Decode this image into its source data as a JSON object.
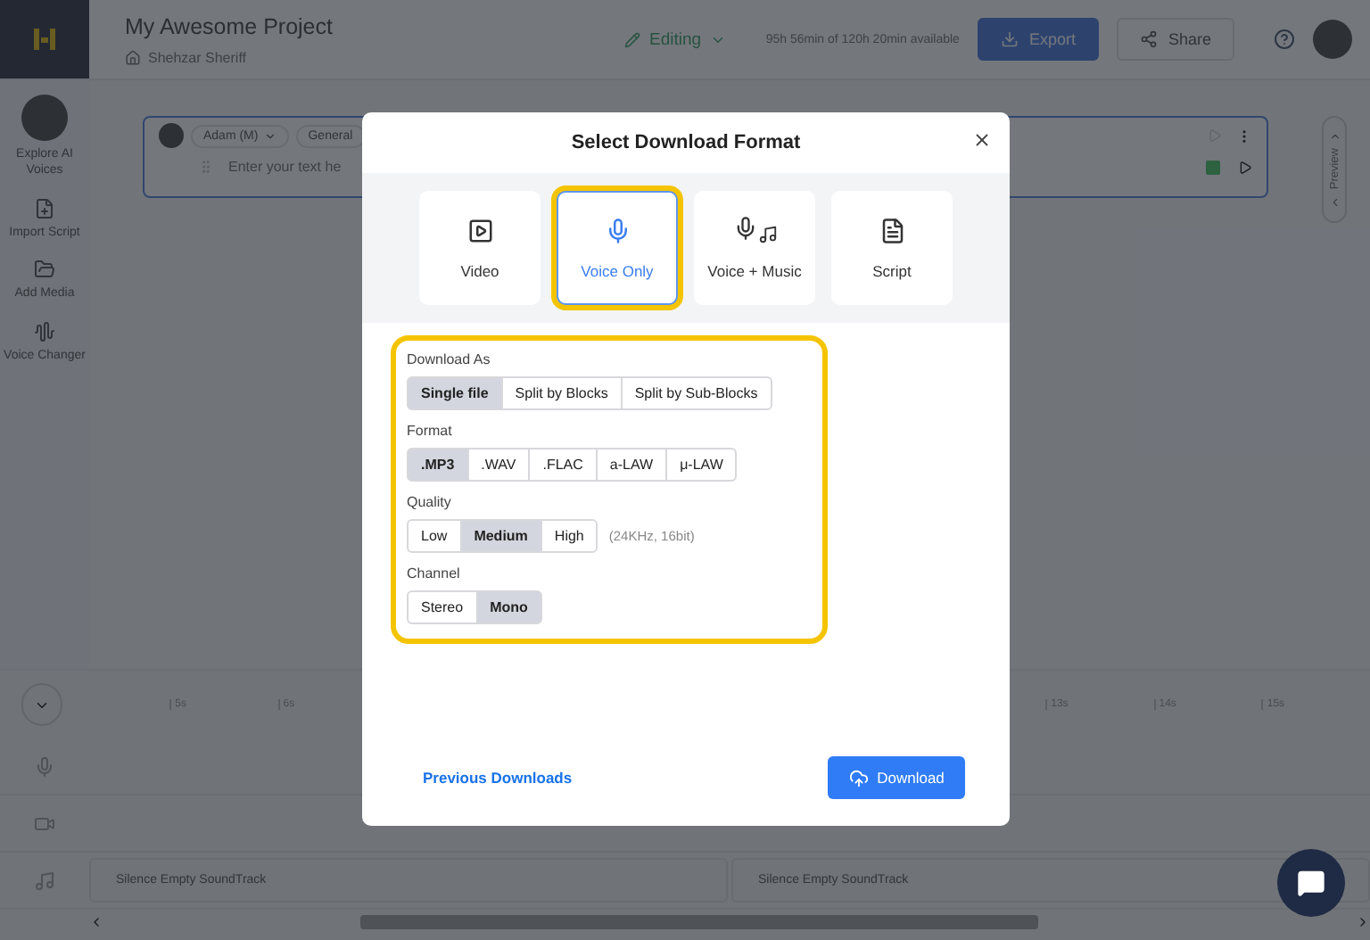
{
  "app": {
    "title": "My Awesome Project",
    "breadcrumb": "Shehzar Sheriff",
    "mode": "Editing",
    "usage": "95h 56min of 120h 20min available",
    "export_button": "Export",
    "share_button": "Share"
  },
  "sidebar": {
    "items": [
      {
        "label": "Explore AI Voices",
        "kind": "avatar"
      },
      {
        "label": "Import Script",
        "kind": "import"
      },
      {
        "label": "Add Media",
        "kind": "media"
      },
      {
        "label": "Voice Changer",
        "kind": "changer"
      }
    ]
  },
  "editor_block": {
    "voice": "Adam (M)",
    "style": "General",
    "placeholder": "Enter your text he"
  },
  "preview_tab": "Preview",
  "timeline": {
    "ticks_left": [
      "5s",
      "6s"
    ],
    "ticks_right": [
      "13s",
      "14s",
      "15s"
    ],
    "tracks": [
      {
        "kind": "voice"
      },
      {
        "kind": "video"
      },
      {
        "kind": "music",
        "clips": [
          "Silence Empty SoundTrack",
          "Silence Empty SoundTrack"
        ]
      }
    ]
  },
  "dialog": {
    "title": "Select Download Format",
    "formats": [
      {
        "label": "Video",
        "kind": "video",
        "selected": false
      },
      {
        "label": "Voice Only",
        "kind": "voice",
        "selected": true
      },
      {
        "label": "Voice + Music",
        "kind": "voice_music",
        "selected": false
      },
      {
        "label": "Script",
        "kind": "script",
        "selected": false
      }
    ],
    "options": [
      {
        "label": "Download As",
        "choices": [
          {
            "label": "Single file",
            "selected": true
          },
          {
            "label": "Split by Blocks",
            "selected": false
          },
          {
            "label": "Split by Sub-Blocks",
            "selected": false
          }
        ]
      },
      {
        "label": "Format",
        "choices": [
          {
            "label": ".MP3",
            "selected": true
          },
          {
            "label": ".WAV",
            "selected": false
          },
          {
            "label": ".FLAC",
            "selected": false
          },
          {
            "label": "a-LAW",
            "selected": false
          },
          {
            "label": "μ-LAW",
            "selected": false
          }
        ]
      },
      {
        "label": "Quality",
        "choices": [
          {
            "label": "Low",
            "selected": false
          },
          {
            "label": "Medium",
            "selected": true
          },
          {
            "label": "High",
            "selected": false
          }
        ],
        "note": "(24KHz, 16bit)"
      },
      {
        "label": "Channel",
        "choices": [
          {
            "label": "Stereo",
            "selected": false
          },
          {
            "label": "Mono",
            "selected": true
          }
        ]
      }
    ],
    "previous_link": "Previous Downloads",
    "download_button": "Download"
  }
}
